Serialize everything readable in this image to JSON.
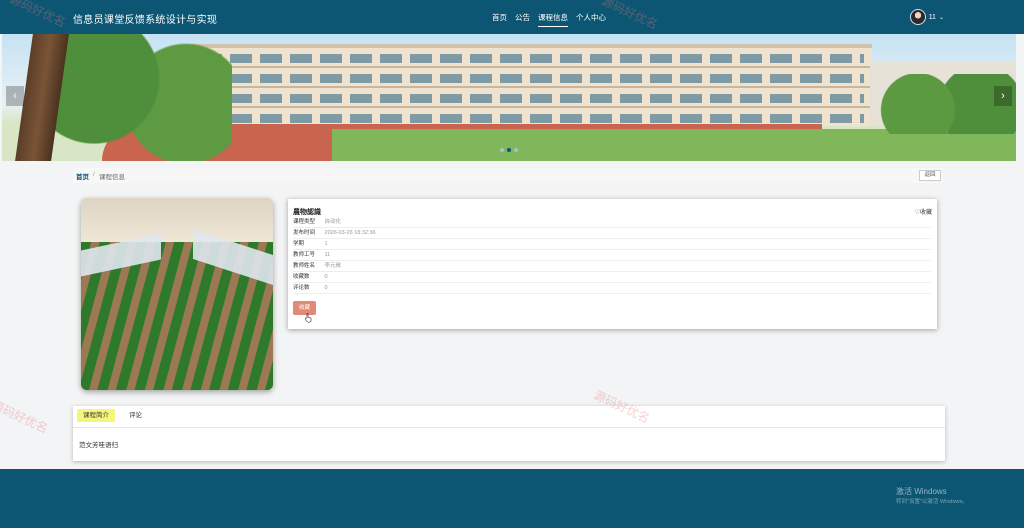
{
  "header": {
    "site_title": "信息员课堂反馈系统设计与实现",
    "nav": [
      {
        "label": "首页"
      },
      {
        "label": "公告"
      },
      {
        "label": "课程信息",
        "active": true
      },
      {
        "label": "个人中心"
      }
    ],
    "user": {
      "name": "11",
      "caret": "⌄"
    }
  },
  "banner": {
    "prev_icon": "chevron-left-icon",
    "next_icon": "chevron-right-icon",
    "slides_count": 3,
    "active_slide": 2
  },
  "breadcrumb": {
    "home": "首页",
    "separator": "/",
    "current": "课程信息",
    "back_label": "返回"
  },
  "course": {
    "name": "農物認識",
    "favorite_label": "♡收藏",
    "fields": [
      {
        "key": "课程类型",
        "value": "自动化"
      },
      {
        "key": "发布时间",
        "value": "2026-03-26 18:32:36"
      },
      {
        "key": "学期",
        "value": "1"
      },
      {
        "key": "教师工号",
        "value": "11"
      },
      {
        "key": "教师姓名",
        "value": "李元敞"
      },
      {
        "key": "收藏数",
        "value": "0"
      },
      {
        "key": "评论数",
        "value": "0"
      }
    ],
    "action_label": "收藏"
  },
  "tabs": {
    "items": [
      {
        "label": "课程简介",
        "active": true
      },
      {
        "label": "评论"
      }
    ],
    "content": "范文芳哇语归"
  },
  "system_overlay": {
    "line1": "激活 Windows",
    "line2": "转到\"设置\"以激活 Windows。"
  },
  "watermark": "源码好优名",
  "colors": {
    "primary": "#0d5673",
    "tab_active_bg": "#f5f57a",
    "action_button": "#e08b78"
  }
}
